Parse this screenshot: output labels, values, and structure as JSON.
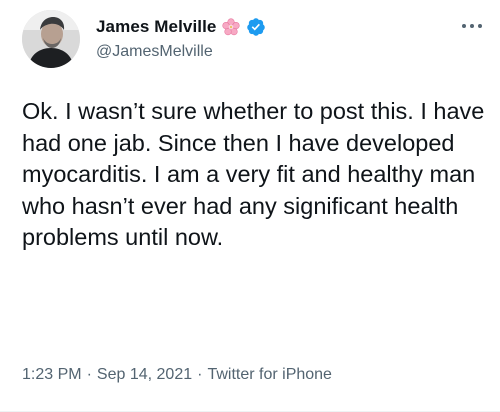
{
  "tweet": {
    "author": {
      "display_name": "James Melville",
      "handle": "@JamesMelville",
      "badges": [
        "cherry-blossom-icon",
        "verified-badge-icon"
      ]
    },
    "text": "Ok. I wasn’t sure whether to post this. I have had one jab. Since then I have developed myocarditis. I am a very fit and healthy man who hasn’t ever had any significant health problems until now.",
    "meta": {
      "time": "1:23 PM",
      "separator": "·",
      "date": "Sep 14, 2021",
      "client": "Twitter for iPhone"
    }
  },
  "colors": {
    "text": "#0f1419",
    "secondary": "#536471",
    "verified": "#1d9bf0"
  }
}
